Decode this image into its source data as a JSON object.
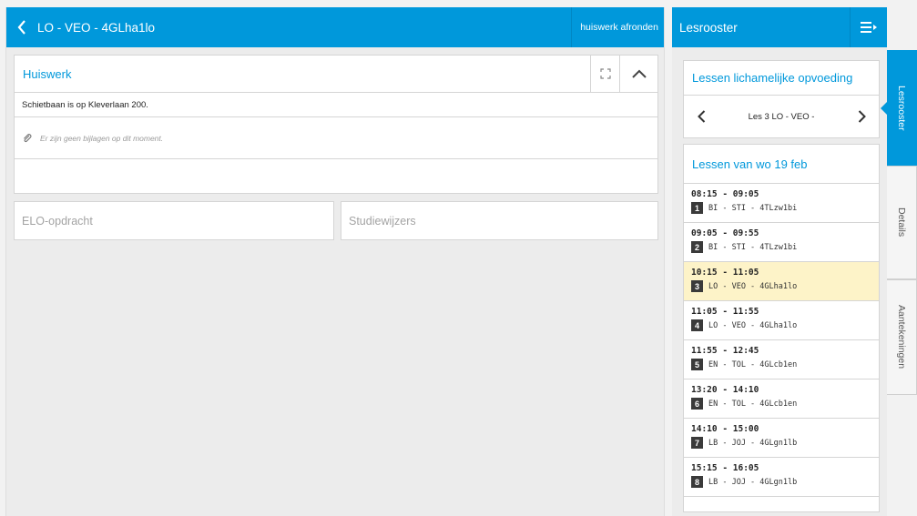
{
  "left_header": {
    "title": "LO - VEO - 4GLha1lo",
    "finish_label": "huiswerk afronden"
  },
  "homework": {
    "title": "Huiswerk",
    "text": "Schietbaan is op Kleverlaan 200.",
    "attachments_text": "Er zijn geen bijlagen op dit moment."
  },
  "sub_cards": {
    "elo_label": "ELO-opdracht",
    "studiewijzers_label": "Studiewijzers"
  },
  "right_header": {
    "title": "Lesrooster"
  },
  "lessons": {
    "title": "Lessen lichamelijke opvoeding",
    "current": "Les 3 LO - VEO -"
  },
  "day": {
    "title": "Lessen van wo 19 feb",
    "items": [
      {
        "time": "08:15 - 09:05",
        "num": "1",
        "desc": "BI - STI - 4TLzw1bi"
      },
      {
        "time": "09:05 - 09:55",
        "num": "2",
        "desc": "BI - STI - 4TLzw1bi"
      },
      {
        "time": "10:15 - 11:05",
        "num": "3",
        "desc": "LO - VEO - 4GLha1lo"
      },
      {
        "time": "11:05 - 11:55",
        "num": "4",
        "desc": "LO - VEO - 4GLha1lo"
      },
      {
        "time": "11:55 - 12:45",
        "num": "5",
        "desc": "EN - TOL - 4GLcb1en"
      },
      {
        "time": "13:20 - 14:10",
        "num": "6",
        "desc": "EN - TOL - 4GLcb1en"
      },
      {
        "time": "14:10 - 15:00",
        "num": "7",
        "desc": "LB - JOJ - 4GLgn1lb"
      },
      {
        "time": "15:15 - 16:05",
        "num": "8",
        "desc": "LB - JOJ - 4GLgn1lb"
      }
    ]
  },
  "tabs": {
    "lesrooster": "Lesrooster",
    "details": "Details",
    "aantekeningen": "Aantekeningen"
  },
  "colors": {
    "accent": "#0098db",
    "active_row": "#fdf3c8"
  }
}
